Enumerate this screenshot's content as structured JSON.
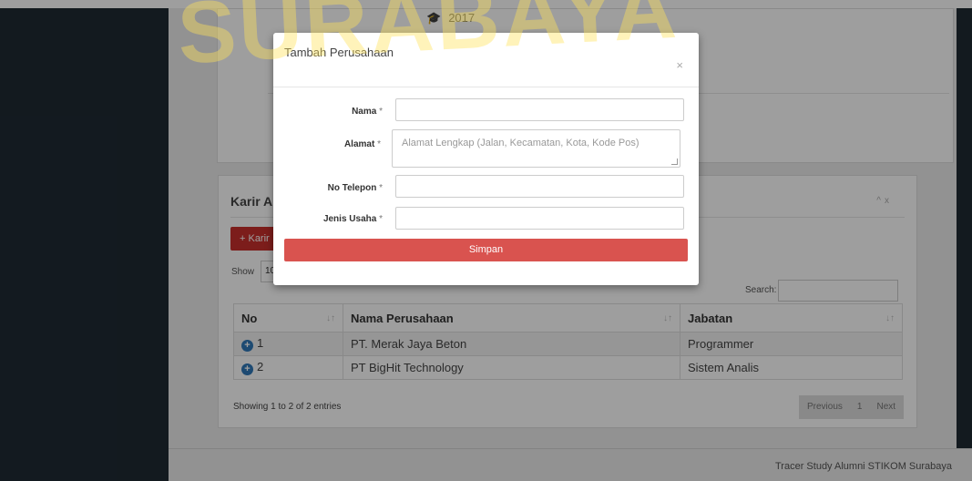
{
  "background": {
    "education_year": "2017",
    "karir_title": "Karir A",
    "karir_button": "+ Karir",
    "show_label": "Show",
    "show_value": "10",
    "search_label": "Search:",
    "table": {
      "headers": [
        "No",
        "Nama Perusahaan",
        "Jabatan"
      ],
      "rows": [
        {
          "no": "1",
          "perusahaan": "PT. Merak Jaya Beton",
          "jabatan": "Programmer"
        },
        {
          "no": "2",
          "perusahaan": "PT BigHit Technology",
          "jabatan": "Sistem Analis"
        }
      ]
    },
    "info": "Showing 1 to 2 of 2 entries",
    "pager": {
      "previous": "Previous",
      "current": "1",
      "next": "Next"
    },
    "footer": "Tracer Study Alumni STIKOM Surabaya"
  },
  "watermark": "SURABAYA",
  "modal": {
    "title": "Tambah Perusahaan",
    "close": "×",
    "fields": {
      "nama_label": "Nama",
      "alamat_label": "Alamat",
      "alamat_placeholder": "Alamat Lengkap (Jalan, Kecamatan, Kota, Kode Pos)",
      "telepon_label": "No Telepon",
      "jenis_label": "Jenis Usaha",
      "required_mark": "*"
    },
    "submit": "Simpan"
  },
  "colors": {
    "submit_button": "#d9534f",
    "karir_button": "#c9302c",
    "sidebar": "#1f2a33",
    "expand_icon": "#2f78b8"
  }
}
